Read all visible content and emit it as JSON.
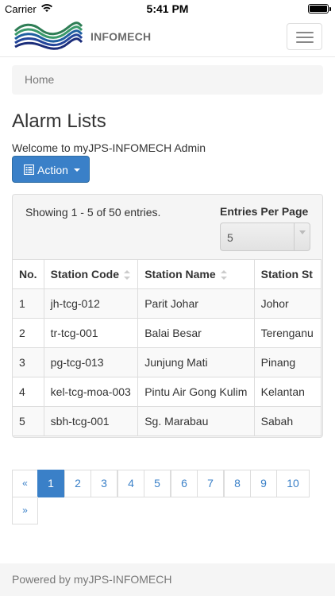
{
  "statusbar": {
    "carrier": "Carrier",
    "time": "5:41 PM"
  },
  "navbar": {
    "brand": "INFOMECH",
    "logo_icon": "wave-logo-icon",
    "menu_icon": "hamburger-menu-icon"
  },
  "breadcrumb": {
    "home": "Home"
  },
  "page": {
    "title": "Alarm Lists",
    "welcome": "Welcome to myJPS-INFOMECH Admin"
  },
  "action": {
    "label": "Action",
    "icon": "list-alt-icon"
  },
  "panel": {
    "showing": "Showing 1 - 5 of 50 entries.",
    "entries_label": "Entries Per Page",
    "entries_value": "5"
  },
  "table": {
    "headers": [
      "No.",
      "Station Code",
      "Station Name",
      "Station St"
    ],
    "rows": [
      [
        "1",
        "jh-tcg-012",
        "Parit Johar",
        "Johor"
      ],
      [
        "2",
        "tr-tcg-001",
        "Balai Besar",
        "Terenganu"
      ],
      [
        "3",
        "pg-tcg-013",
        "Junjung Mati",
        "Pinang"
      ],
      [
        "4",
        "kel-tcg-moa-003",
        "Pintu Air Gong Kulim",
        "Kelantan"
      ],
      [
        "5",
        "sbh-tcg-001",
        "Sg. Marabau",
        "Sabah"
      ]
    ]
  },
  "pagination": {
    "prev": "«",
    "pages": [
      "1",
      "2",
      "3",
      "4",
      "5",
      "6",
      "7",
      "8",
      "9",
      "10"
    ],
    "next": "»",
    "active_page": "1"
  },
  "footer": {
    "text": "Powered by myJPS-INFOMECH"
  },
  "colors": {
    "primary": "#3a80c8",
    "panel_bg": "#f5f5f5",
    "border": "#dddddd"
  }
}
